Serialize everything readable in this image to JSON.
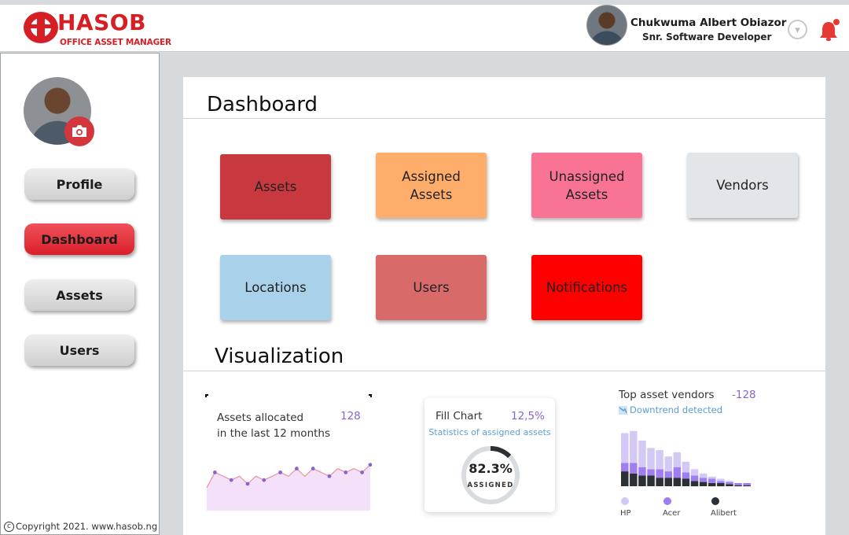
{
  "brand": {
    "name": "HASOB",
    "subtitle": "OFFICE ASSET MANAGER",
    "color": "#d51f25"
  },
  "user": {
    "name": "Chukwuma Albert Obiazor",
    "role": "Snr. Software Developer"
  },
  "header_icons": [
    "chevron-down-icon",
    "bell-icon"
  ],
  "sidebar": {
    "items": [
      {
        "label": "Profile",
        "active": false
      },
      {
        "label": "Dashboard",
        "active": true
      },
      {
        "label": "Assets",
        "active": false
      },
      {
        "label": "Users",
        "active": false
      }
    ],
    "copyright": "Copyright 2021. www.hasob.ng"
  },
  "main": {
    "title": "Dashboard",
    "tiles": [
      {
        "label": "Assets",
        "color": "#c8383f"
      },
      {
        "label": "Assigned Assets",
        "color": "#ffad6b"
      },
      {
        "label": "Unassigned Assets",
        "color": "#f97494"
      },
      {
        "label": "Vendors",
        "color": "#e2e6ea"
      },
      {
        "label": "Locations",
        "color": "#a9d1ea"
      },
      {
        "label": "Users",
        "color": "#d96a6a"
      },
      {
        "label": "Notifications",
        "color": "#fe0000"
      }
    ],
    "visualization_title": "Visualization"
  },
  "charts": {
    "line": {
      "title_line1": "Assets allocated",
      "title_line2": "in the last 12 months",
      "value": "128"
    },
    "fill": {
      "title": "Fill Chart",
      "value": "12,5%",
      "subtitle": "Statistics of assigned assets",
      "gauge_value": "82.3%",
      "gauge_label": "ASSIGNED",
      "gauge_fraction": 0.123
    },
    "bar": {
      "title": "Top asset vendors",
      "value": "-128",
      "trend": "Downtrend detected"
    }
  },
  "chart_data": [
    {
      "type": "area",
      "title": "Assets allocated in the last 12 months",
      "series": [
        {
          "values": [
            26,
            30,
            29,
            28,
            29,
            27,
            29,
            28,
            29,
            30,
            29,
            31,
            29,
            31,
            30,
            29,
            31,
            30,
            31,
            30,
            32
          ]
        }
      ]
    },
    {
      "type": "pie",
      "title": "Fill Chart",
      "values": [
        12.5,
        87.5
      ]
    },
    {
      "type": "bar",
      "title": "Top asset vendors",
      "series": [
        {
          "name": "HP",
          "values": [
            28,
            30,
            25,
            20,
            18,
            14,
            14,
            10,
            6,
            4,
            2,
            2,
            1,
            0,
            0
          ]
        },
        {
          "name": "Acer",
          "values": [
            8,
            10,
            8,
            6,
            8,
            6,
            10,
            6,
            5,
            4,
            4,
            2,
            2,
            2,
            2
          ]
        },
        {
          "name": "Alibert",
          "values": [
            14,
            12,
            10,
            10,
            8,
            8,
            8,
            7,
            5,
            4,
            3,
            3,
            2,
            1,
            1
          ]
        }
      ],
      "colors": [
        "#d4c8f4",
        "#9f7ef0",
        "#2b2f36"
      ]
    }
  ]
}
